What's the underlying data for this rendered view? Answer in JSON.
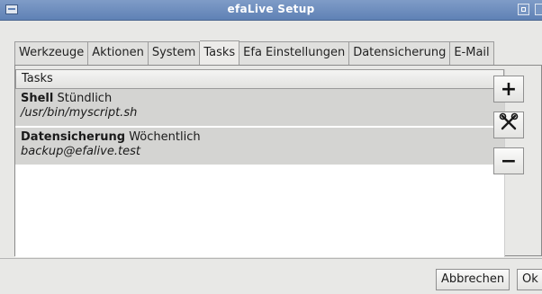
{
  "window": {
    "title": "efaLive Setup"
  },
  "tabs": [
    {
      "label": "Werkzeuge"
    },
    {
      "label": "Aktionen"
    },
    {
      "label": "System"
    },
    {
      "label": "Tasks",
      "active": true
    },
    {
      "label": "Efa Einstellungen"
    },
    {
      "label": "Datensicherung"
    },
    {
      "label": "E-Mail"
    }
  ],
  "tasks": {
    "header": "Tasks",
    "items": [
      {
        "name": "Shell",
        "interval": "Stündlich",
        "detail": "/usr/bin/myscript.sh"
      },
      {
        "name": "Datensicherung",
        "interval": "Wöchentlich",
        "detail": "backup@efalive.test"
      }
    ]
  },
  "side_buttons": {
    "add": "+",
    "edit_icon": "tools-icon",
    "remove": "−"
  },
  "footer": {
    "cancel_label": "Abbrechen",
    "ok_label": "Ok"
  }
}
